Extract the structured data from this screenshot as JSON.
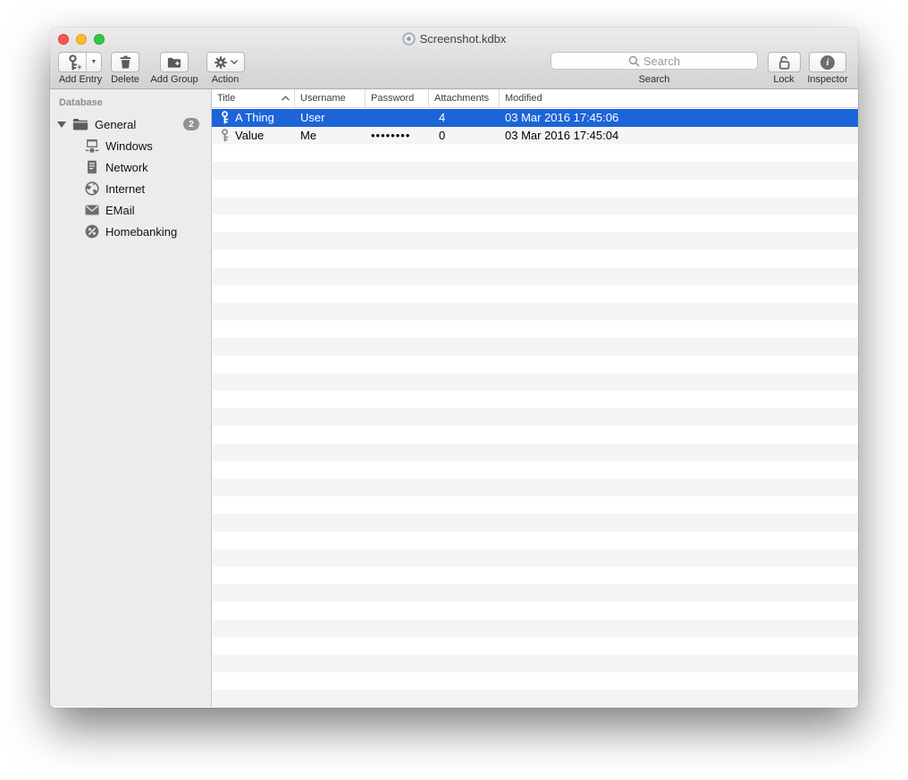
{
  "window": {
    "title": "Screenshot.kdbx",
    "proxy_icon": "kdbx-document-icon"
  },
  "traffic_lights": {
    "close": "#fc5753",
    "minimize": "#fdbc2e",
    "zoom": "#33c748"
  },
  "toolbar": {
    "add_entry": {
      "label": "Add Entry",
      "icon": "key-plus-icon",
      "dropdown_icon": "chevron-down-icon"
    },
    "delete": {
      "label": "Delete",
      "icon": "trash-icon"
    },
    "add_group": {
      "label": "Add Group",
      "icon": "folder-plus-icon"
    },
    "action": {
      "label": "Action",
      "icon": "gear-icon",
      "dropdown_icon": "chevron-down-icon"
    },
    "search": {
      "placeholder": "Search",
      "label": "Search",
      "icon": "magnifier-icon"
    },
    "lock": {
      "label": "Lock",
      "icon": "open-padlock-icon"
    },
    "inspector": {
      "label": "Inspector",
      "icon": "info-icon",
      "info_glyph": "i"
    }
  },
  "sidebar": {
    "header": "Database",
    "group": {
      "label": "General",
      "badge": "2",
      "icon": "folder-icon",
      "expanded": true
    },
    "items": [
      {
        "label": "Windows",
        "icon": "windows-network-icon"
      },
      {
        "label": "Network",
        "icon": "server-icon"
      },
      {
        "label": "Internet",
        "icon": "globe-icon"
      },
      {
        "label": "EMail",
        "icon": "envelope-icon"
      },
      {
        "label": "Homebanking",
        "icon": "percent-coin-icon"
      }
    ]
  },
  "table": {
    "columns": {
      "title": "Title",
      "username": "Username",
      "password": "Password",
      "attachments": "Attachments",
      "modified": "Modified"
    },
    "sort": {
      "column": "Title",
      "direction": "ascending",
      "icon": "chevron-up-icon"
    },
    "rows": [
      {
        "icon": "key-icon",
        "title": "A Thing",
        "username": "User",
        "password": "",
        "attachments": "4",
        "modified": "03 Mar 2016 17:45:06",
        "selected": true
      },
      {
        "icon": "key-icon",
        "title": "Value",
        "username": "Me",
        "password": "••••••••",
        "attachments": "0",
        "modified": "03 Mar 2016 17:45:04",
        "selected": false
      }
    ]
  },
  "colors": {
    "selection": "#1b64d9",
    "stripe": "#f4f5f5",
    "sidebar_bg": "#ececec",
    "chrome_top": "#ececec",
    "chrome_bottom": "#d2d2d2"
  }
}
